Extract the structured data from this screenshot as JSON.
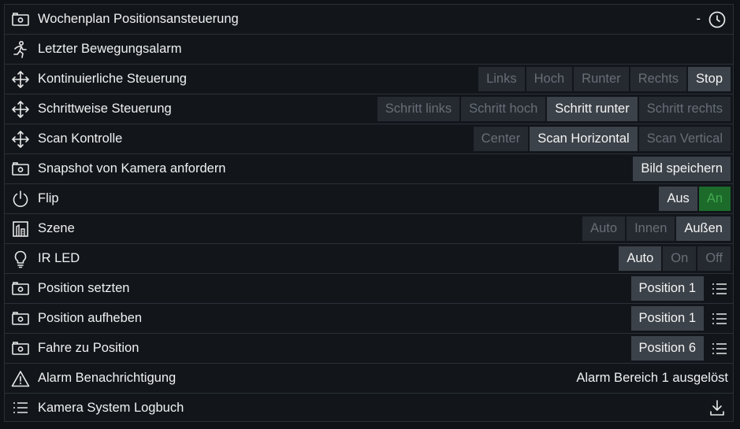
{
  "rows": [
    {
      "label": "Wochenplan Positionsansteuerung",
      "icon": "camera-icon",
      "value": "-"
    },
    {
      "label": "Letzter Bewegungsalarm",
      "icon": "running-person-icon"
    },
    {
      "label": "Kontinuierliche Steuerung",
      "icon": "move-arrows-icon",
      "buttons": [
        "Links",
        "Hoch",
        "Runter",
        "Rechts",
        "Stop"
      ],
      "active": "Stop"
    },
    {
      "label": "Schrittweise Steuerung",
      "icon": "move-arrows-icon",
      "buttons": [
        "Schritt links",
        "Schritt hoch",
        "Schritt runter",
        "Schritt rechts"
      ],
      "active": "Schritt runter"
    },
    {
      "label": "Scan Kontrolle",
      "icon": "move-arrows-icon",
      "buttons": [
        "Center",
        "Scan Horizontal",
        "Scan Vertical"
      ],
      "active": "Scan Horizontal"
    },
    {
      "label": "Snapshot von Kamera anfordern",
      "icon": "camera-icon",
      "button": "Bild speichern"
    },
    {
      "label": "Flip",
      "icon": "power-icon",
      "buttons": [
        "Aus",
        "An"
      ],
      "active": "Aus",
      "green": "An"
    },
    {
      "label": "Szene",
      "icon": "scene-icon",
      "buttons": [
        "Auto",
        "Innen",
        "Außen"
      ],
      "active": "Außen"
    },
    {
      "label": "IR LED",
      "icon": "lightbulb-icon",
      "buttons": [
        "Auto",
        "On",
        "Off"
      ],
      "active": "Auto"
    },
    {
      "label": "Position setzten",
      "icon": "camera-icon",
      "select": "Position 1"
    },
    {
      "label": "Position aufheben",
      "icon": "camera-icon",
      "select": "Position 1"
    },
    {
      "label": "Fahre zu Position",
      "icon": "camera-icon",
      "select": "Position 6"
    },
    {
      "label": "Alarm Benachrichtigung",
      "icon": "warning-icon",
      "status": "Alarm Bereich 1 ausgelöst"
    },
    {
      "label": "Kamera System Logbuch",
      "icon": "list-icon"
    }
  ],
  "colors": {
    "background": "#12161b",
    "button": "#252a31",
    "button_active": "#3c4249",
    "green": "#1c6b2a"
  }
}
